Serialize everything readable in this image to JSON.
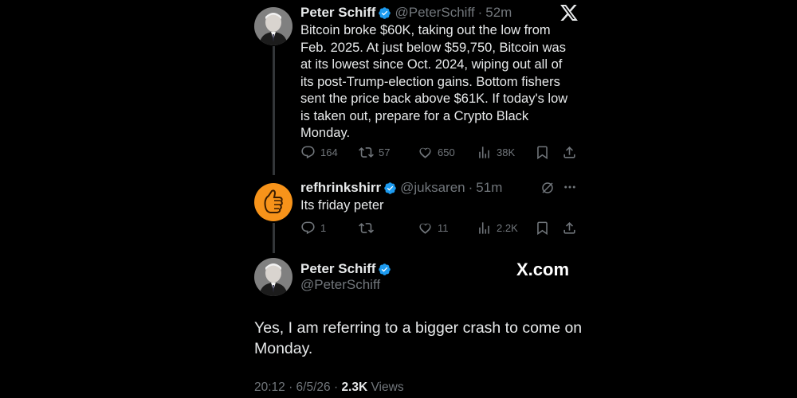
{
  "header": {
    "platform_icon": "x-logo-icon"
  },
  "tweets": [
    {
      "display_name": "Peter Schiff",
      "handle": "@PeterSchiff",
      "time": "52m",
      "verified_icon": "verified-badge-icon",
      "text": "Bitcoin broke $60K, taking out the low from Feb. 2025. At just below $59,750, Bitcoin was at its lowest since Oct. 2024, wiping out all of its post-Trump-election gains. Bottom fishers sent the price back above $61K. If today's low is taken out, prepare for a Crypto Black Monday.",
      "replies": "164",
      "reposts": "57",
      "likes": "650",
      "views": "38K"
    },
    {
      "display_name": "refhrinkshirr",
      "handle": "@juksaren",
      "time": "51m",
      "verified_icon": "verified-badge-icon",
      "text": "Its friday peter",
      "replies": "1",
      "reposts": "",
      "likes": "11",
      "views": "2.2K"
    }
  ],
  "main_tweet": {
    "display_name": "Peter Schiff",
    "handle": "@PeterSchiff",
    "watermark": "X.com",
    "text": "Yes, I am referring to a bigger crash to come on Monday.",
    "timestamp": "20:12 · 6/5/26 ·",
    "views_count": "2.3K",
    "views_label": "Views"
  },
  "colors": {
    "background": "#000000",
    "text_primary": "#e7e9ea",
    "text_secondary": "#71767b",
    "verified": "#1d9bf0",
    "avatar_orange": "#f7931a"
  }
}
